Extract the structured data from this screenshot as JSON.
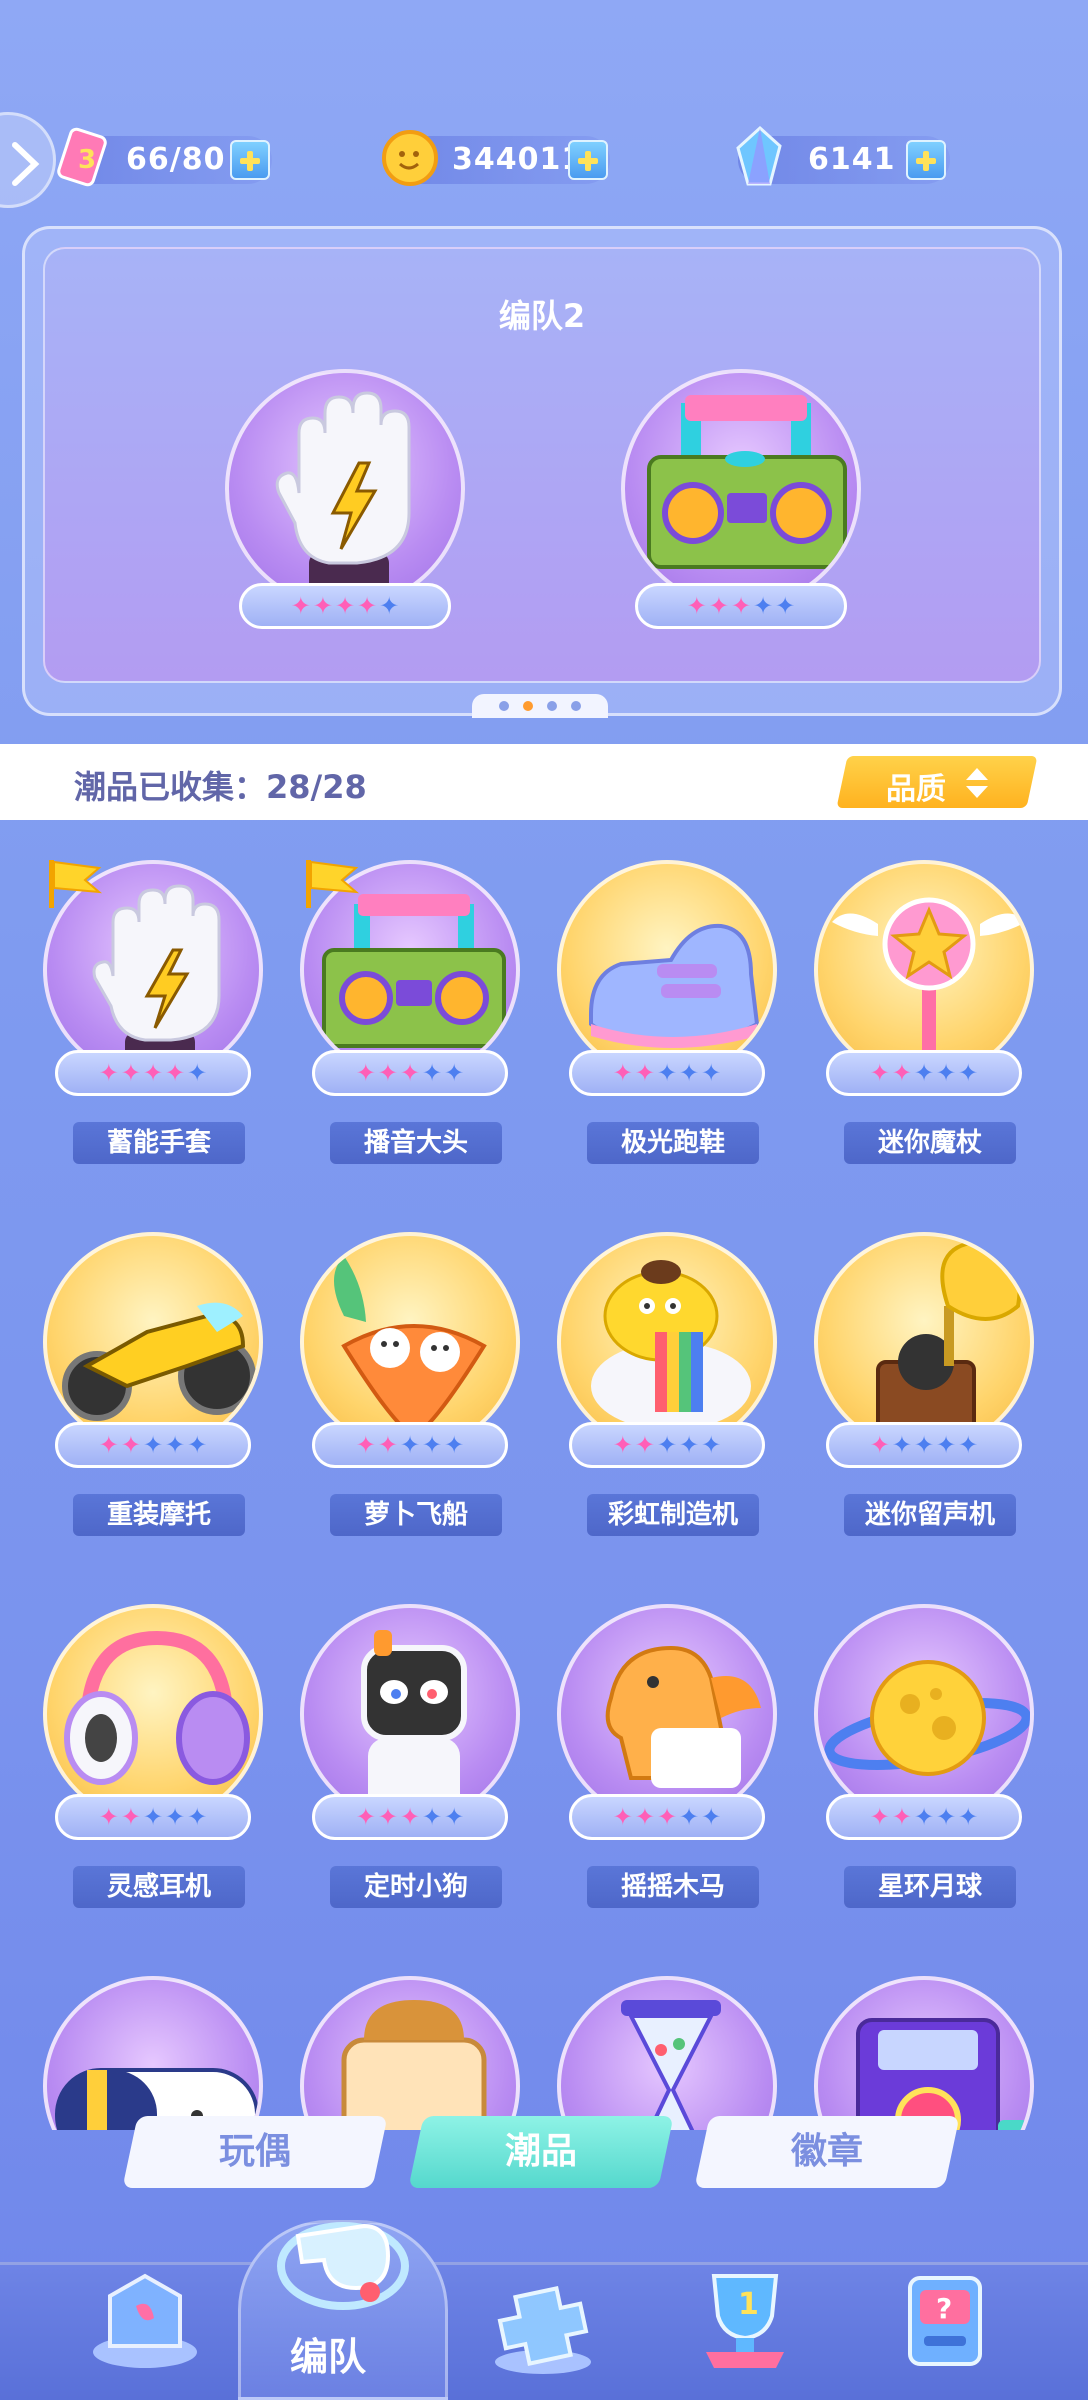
{
  "currencies": [
    {
      "name": "stamina",
      "value": "66/80",
      "icon": "energy-card-icon"
    },
    {
      "name": "coins",
      "value": "344011",
      "icon": "gold-coin-icon"
    },
    {
      "name": "gems",
      "value": "6141",
      "icon": "blue-crystal-icon"
    }
  ],
  "team": {
    "title": "编队2",
    "slots": [
      {
        "item": "glove",
        "stars_on": 4,
        "stars_total": 5
      },
      {
        "item": "boombox",
        "stars_on": 3,
        "stars_total": 5
      }
    ],
    "page_count": 4,
    "active_page": 1
  },
  "collection": {
    "label": "潮品已收集：28/28",
    "sort_label": "品质"
  },
  "items": [
    {
      "name": "蓄能手套",
      "stars_on": 4,
      "bg": "purple",
      "flag": true,
      "art": "glove"
    },
    {
      "name": "播音大头",
      "stars_on": 3,
      "bg": "purple",
      "flag": true,
      "art": "boombox"
    },
    {
      "name": "极光跑鞋",
      "stars_on": 2,
      "bg": "gold",
      "flag": false,
      "art": "shoe"
    },
    {
      "name": "迷你魔杖",
      "stars_on": 2,
      "bg": "gold",
      "flag": false,
      "art": "wand"
    },
    {
      "name": "重装摩托",
      "stars_on": 2,
      "bg": "gold",
      "flag": false,
      "art": "moto"
    },
    {
      "name": "萝卜飞船",
      "stars_on": 2,
      "bg": "gold",
      "flag": false,
      "art": "carrot"
    },
    {
      "name": "彩虹制造机",
      "stars_on": 2,
      "bg": "gold",
      "flag": false,
      "art": "rainbow"
    },
    {
      "name": "迷你留声机",
      "stars_on": 1,
      "bg": "gold",
      "flag": false,
      "art": "gramophone"
    },
    {
      "name": "灵感耳机",
      "stars_on": 2,
      "bg": "gold",
      "flag": false,
      "art": "headphones"
    },
    {
      "name": "定时小狗",
      "stars_on": 3,
      "bg": "purple",
      "flag": false,
      "art": "dog"
    },
    {
      "name": "摇摇木马",
      "stars_on": 3,
      "bg": "purple",
      "flag": false,
      "art": "horse"
    },
    {
      "name": "星环月球",
      "stars_on": 2,
      "bg": "purple",
      "flag": false,
      "art": "moon"
    },
    {
      "name": "",
      "stars_on": 0,
      "bg": "purple",
      "flag": false,
      "art": "capsule"
    },
    {
      "name": "",
      "stars_on": 0,
      "bg": "purple",
      "flag": false,
      "art": "toast"
    },
    {
      "name": "",
      "stars_on": 0,
      "bg": "purple",
      "flag": false,
      "art": "hourglass"
    },
    {
      "name": "",
      "stars_on": 0,
      "bg": "purple",
      "flag": false,
      "art": "camera"
    }
  ],
  "tabs": [
    {
      "label": "玩偶",
      "active": false
    },
    {
      "label": "潮品",
      "active": true
    },
    {
      "label": "徽章",
      "active": false
    }
  ],
  "nav": {
    "active_label": "编队",
    "items": [
      "home-icon",
      "whistle-icon",
      "gamepad-icon",
      "trophy-icon",
      "slot-machine-icon"
    ]
  },
  "colors": {
    "star_on": "#ff5fb7",
    "star_off": "#4d7ff0",
    "accent_gold": "#ffb21f",
    "active_tab": "#55d8cd"
  }
}
